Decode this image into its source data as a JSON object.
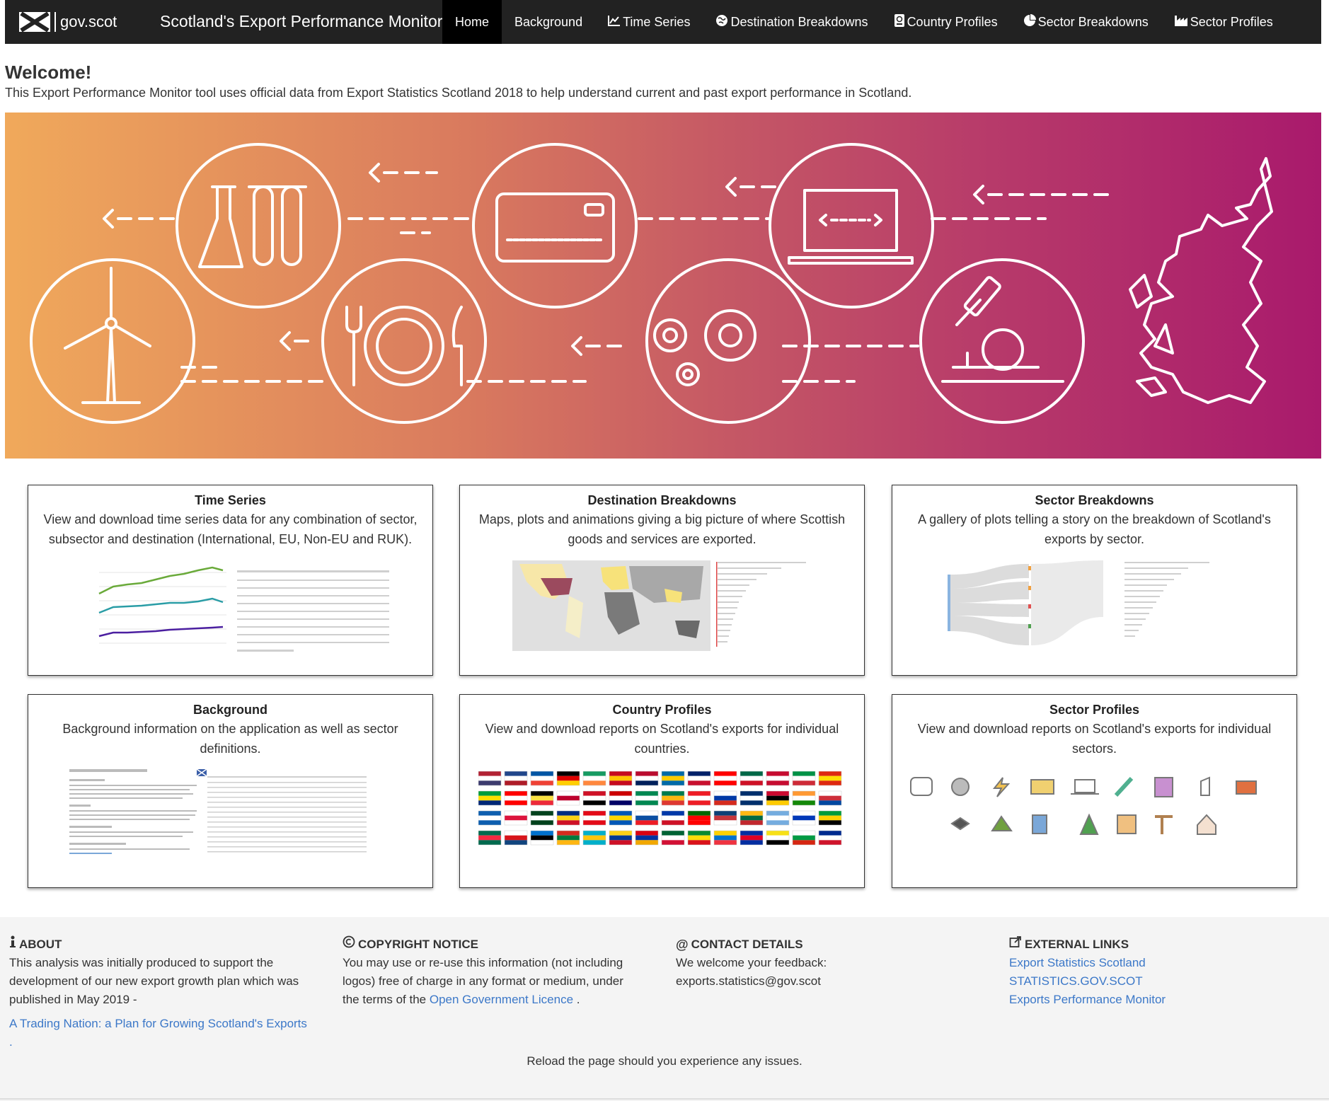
{
  "navbar": {
    "brand": "gov.scot",
    "title": "Scotland's Export Performance Monitor",
    "items": [
      {
        "label": "Home",
        "icon": ""
      },
      {
        "label": "Background",
        "icon": ""
      },
      {
        "label": "Time Series",
        "icon": "line-chart-icon"
      },
      {
        "label": "Destination Breakdowns",
        "icon": "globe-icon"
      },
      {
        "label": "Country Profiles",
        "icon": "passport-icon"
      },
      {
        "label": "Sector Breakdowns",
        "icon": "pie-chart-icon"
      },
      {
        "label": "Sector Profiles",
        "icon": "industry-icon"
      }
    ]
  },
  "welcome": {
    "title": "Welcome!",
    "text": "This Export Performance Monitor tool uses official data from Export Statistics Scotland 2018 to help understand current and past export performance in Scotland."
  },
  "cards": [
    {
      "title": "Time Series",
      "desc": "View and download time series data for any combination of sector, subsector and destination (International, EU, Non-EU and RUK)."
    },
    {
      "title": "Destination Breakdowns",
      "desc": "Maps, plots and animations giving a big picture of where Scottish goods and services are exported."
    },
    {
      "title": "Sector Breakdowns",
      "desc": "A gallery of plots telling a story on the breakdown of Scotland's exports by sector."
    },
    {
      "title": "Background",
      "desc": "Background information on the application as well as sector definitions."
    },
    {
      "title": "Country Profiles",
      "desc": "View and download reports on Scotland's exports for individual countries."
    },
    {
      "title": "Sector Profiles",
      "desc": "View and download reports on Scotland's exports for individual sectors."
    }
  ],
  "footer": {
    "about": {
      "heading": "ABOUT",
      "text": "This analysis was initially produced to support the development of our new export growth plan which was published in May 2019 -",
      "link": "A Trading Nation: a Plan for Growing Scotland's Exports",
      "after": "."
    },
    "copyright": {
      "heading": "COPYRIGHT NOTICE",
      "text": "You may use or re-use this information (not including logos) free of charge in any format or medium, under the terms of the",
      "link": "Open Government Licence",
      "after": "."
    },
    "contact": {
      "heading": "CONTACT DETAILS",
      "line1": "We welcome your feedback:",
      "line2": "exports.statistics@gov.scot"
    },
    "external": {
      "heading": "EXTERNAL LINKS",
      "links": [
        "Export Statistics Scotland",
        "STATISTICS.GOV.SCOT",
        "Exports Performance Monitor"
      ]
    },
    "reload": "Reload the page should you experience any issues."
  },
  "colors": {
    "navbar": "#222222",
    "banner_start": "#f0a95b",
    "banner_end": "#a91a6c",
    "link": "#3c78c8"
  }
}
